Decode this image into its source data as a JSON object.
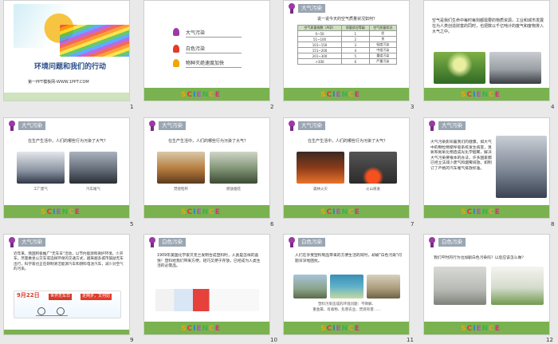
{
  "slides": {
    "s1": {
      "title": "环境问题和我们的行动",
      "subtitle": "第一PPT模板网-WWW.1PPT.COM",
      "num": "1"
    },
    "s2": {
      "items": [
        "大气污染",
        "白色污染",
        "物种灭绝速度加快"
      ],
      "num": "2"
    },
    "s3": {
      "header": "大气污染",
      "question": "说一说今天的空气质量状况如何？",
      "table": [
        [
          "空气质量指数（AQI）",
          "质量状况等级",
          "空气质量状况"
        ],
        [
          "0~50",
          "1",
          "优"
        ],
        [
          "51~100",
          "2",
          "良"
        ],
        [
          "101~150",
          "3",
          "轻度污染"
        ],
        [
          "151~200",
          "4",
          "中度污染"
        ],
        [
          "201~300",
          "5",
          "重度污染"
        ],
        [
          ">300",
          "6",
          "严重污染"
        ]
      ],
      "num": "3"
    },
    "s4": {
      "text": "空气是我们生命中每时每刻都需要的物质资源，工业和城市发展在为人类创造财富的同时，也把数以千亿吨计的废气和废物排入大气之中。",
      "num": "4"
    },
    "s5": {
      "header": "大气污染",
      "text": "在生产生活中，人们的哪些行为污染了大气？",
      "cap1": "工厂废气",
      "cap2": "汽车尾气",
      "num": "5"
    },
    "s6": {
      "header": "大气污染",
      "text": "在生产生活中，人们的哪些行为污染了大气？",
      "cap1": "焚烧秸秆",
      "cap2": "燃放烟花",
      "num": "6"
    },
    "s7": {
      "header": "大气污染",
      "text": "在生产生活中，人们的哪些行为污染了大气？",
      "cap1": "森林火灾",
      "cap2": "火山喷发",
      "num": "7"
    },
    "s8": {
      "header": "大气污染",
      "text": "大气污染影响着我们的健康。如大气中的颗粒物使呼吸系统发生病变，臭氧和氮氧化物造成光化学烟雾，解决大气污染要根本的办法，许多国家都已经立法减少废气和烟雾排放。如制订了严格的汽车尾气排放标准。",
      "num": "8"
    },
    "s9": {
      "header": "大气污染",
      "text": "近年来，我国积极推广\"无车日\"活动，以节约能源和保护环境，少开车。尽量乘坐公交车或选择环保的交通方式，越来越多城市鼓励无车出行，科学家也正在研制清洁能源汽车和燃料电池汽车，减少对空气的污染。",
      "banner_date": "9月22日",
      "banner_label": "世界无车日",
      "banner_slogan": "走两步，又何妨",
      "num": "9"
    },
    "s10": {
      "header": "白色污染",
      "text": "1909年美国化学家贝克兰发明合成塑料时，人类是怎样的喜悦！塑料给我们带来方便，轻巧又便于存放，已经成为人类生活的必需品。",
      "num": "10"
    },
    "s11": {
      "header": "白色污染",
      "text": "人们在享受塑料制品带来的方便生活的同时，却被\"白色污染\"问题深深地困扰。",
      "cap": "塑料污染造成的环境问题：不降解、",
      "cap2": "重金属、有毒物、危害农业、焚烧有害……",
      "num": "11"
    },
    "s12": {
      "header": "白色污染",
      "text": "我们平时的行为也加剧白色污染吗？以后应该怎么做？",
      "num": "12"
    },
    "science": [
      "S",
      "C",
      "I",
      "E",
      "N",
      "C",
      "E"
    ]
  }
}
